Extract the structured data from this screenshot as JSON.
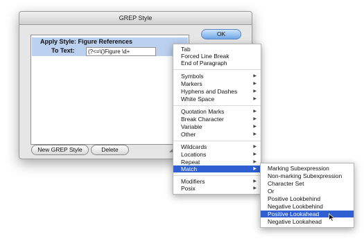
{
  "window": {
    "title": "GREP Style"
  },
  "panel": {
    "apply_style_label": "Apply Style: Figure References",
    "to_text_label": "To Text:",
    "to_text_value": "(?<=\\()Figure \\d+",
    "special_char_button": "@"
  },
  "buttons": {
    "ok": "OK",
    "new_grep_style": "New GREP Style",
    "delete": "Delete"
  },
  "main_menu": {
    "items": [
      "Tab",
      "Forced Line Break",
      "End of Paragraph",
      "Symbols",
      "Markers",
      "Hyphens and Dashes",
      "White Space",
      "Quotation Marks",
      "Break Character",
      "Variable",
      "Other",
      "Wildcards",
      "Locations",
      "Repeat",
      "Match",
      "Modifiers",
      "Posix"
    ],
    "selected": "Match"
  },
  "match_submenu": {
    "items": [
      "Marking Subexpression",
      "Non-marking Subexpression",
      "Character Set",
      "Or",
      "Positive Lookbehind",
      "Negative Lookbehind",
      "Positive Lookahead",
      "Negative Lookahead"
    ],
    "selected": "Positive Lookahead"
  },
  "colors": {
    "selection": "#2f5fd0",
    "panel_highlight": "#bcd0ef",
    "ok_button": "#6ea7e8"
  },
  "icons": {
    "submenu_arrow": "triangle-right-icon",
    "cursor": "arrow-cursor-icon",
    "resize": "resize-grip-icon"
  }
}
